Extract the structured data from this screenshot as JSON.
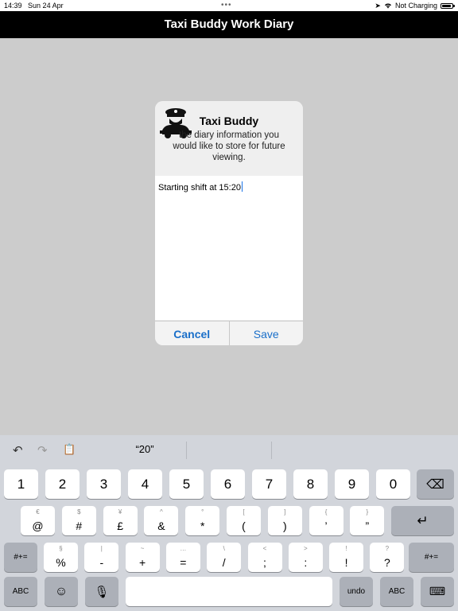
{
  "status": {
    "time": "14:39",
    "date": "Sun 24 Apr",
    "charging": "Not Charging",
    "battery_level": 0.9
  },
  "nav": {
    "title": "Taxi Buddy Work Diary"
  },
  "alert": {
    "title": "Taxi Buddy",
    "message": "the diary information you would like to store for future viewing.",
    "text_value": "Starting shift at 15:20",
    "cancel_label": "Cancel",
    "save_label": "Save"
  },
  "keyboard": {
    "suggestion": "“20”",
    "row1": [
      "1",
      "2",
      "3",
      "4",
      "5",
      "6",
      "7",
      "8",
      "9",
      "0"
    ],
    "row2": [
      {
        "alt": "€",
        "main": "@"
      },
      {
        "alt": "$",
        "main": "#"
      },
      {
        "alt": "¥",
        "main": "£"
      },
      {
        "alt": "^",
        "main": "&"
      },
      {
        "alt": "°",
        "main": "*"
      },
      {
        "alt": "[",
        "main": "("
      },
      {
        "alt": "]",
        "main": ")"
      },
      {
        "alt": "{",
        "main": "’"
      },
      {
        "alt": "}",
        "main": "”"
      }
    ],
    "row3": [
      {
        "alt": "§",
        "main": "%"
      },
      {
        "alt": "|",
        "main": "-"
      },
      {
        "alt": "~",
        "main": "+"
      },
      {
        "alt": "…",
        "main": "="
      },
      {
        "alt": "\\",
        "main": "/"
      },
      {
        "alt": "<",
        "main": ";"
      },
      {
        "alt": ">",
        "main": ":"
      },
      {
        "alt": "!",
        "main": "!"
      },
      {
        "alt": "?",
        "main": "?"
      }
    ],
    "shift_left": "#+=",
    "shift_right": "#+=",
    "abc_left": "ABC",
    "undo": "undo",
    "abc_right": "ABC"
  }
}
